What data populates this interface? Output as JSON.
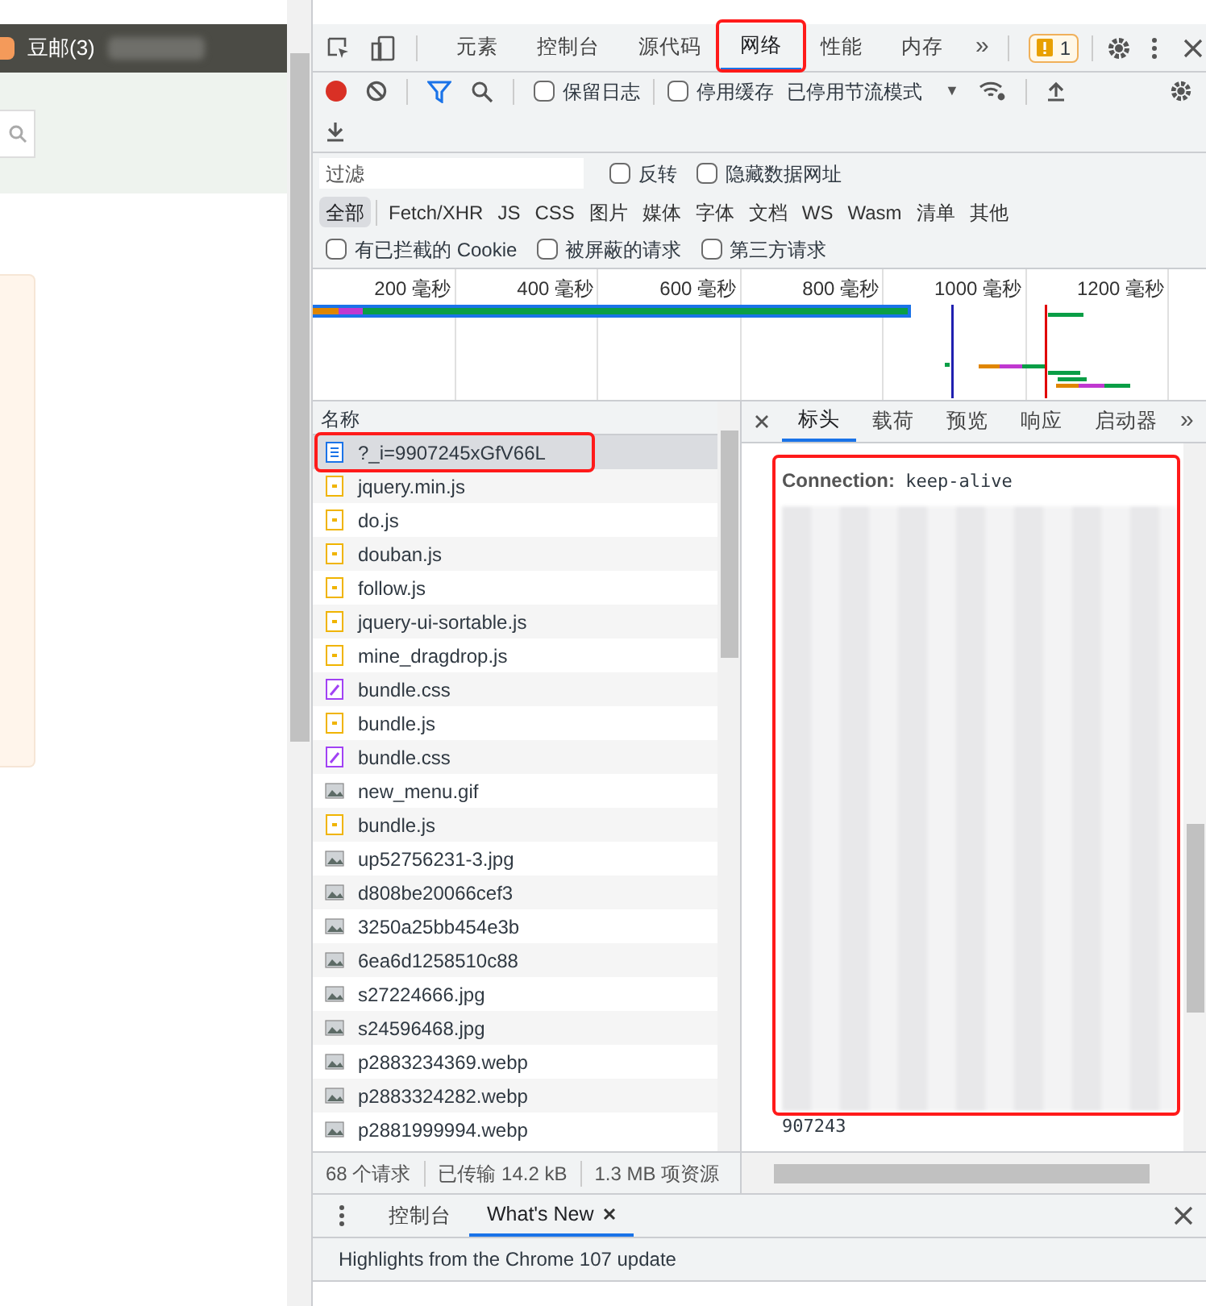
{
  "page": {
    "mail_link": "豆邮(3)"
  },
  "devtools": {
    "tabs": [
      {
        "label": "元素",
        "selected": false,
        "annotated": false
      },
      {
        "label": "控制台",
        "selected": false,
        "annotated": false
      },
      {
        "label": "源代码",
        "selected": false,
        "annotated": false
      },
      {
        "label": "网络",
        "selected": true,
        "annotated": true
      },
      {
        "label": "性能",
        "selected": false,
        "annotated": false
      },
      {
        "label": "内存",
        "selected": false,
        "annotated": false
      }
    ],
    "more_tabs": "»",
    "issues_count": "1",
    "toolbar": {
      "recording": true,
      "preserve_log": {
        "label": "保留日志",
        "checked": false
      },
      "disable_cache": {
        "label": "停用缓存",
        "checked": false
      },
      "throttling": "已停用节流模式",
      "throttling_caret": "▼"
    },
    "filter": {
      "placeholder": "过滤",
      "options": [
        {
          "label": "反转",
          "checked": false
        },
        {
          "label": "隐藏数据网址",
          "checked": false
        }
      ]
    },
    "types": [
      {
        "label": "全部",
        "selected": true
      },
      {
        "label": "Fetch/XHR",
        "selected": false
      },
      {
        "label": "JS",
        "selected": false
      },
      {
        "label": "CSS",
        "selected": false
      },
      {
        "label": "图片",
        "selected": false
      },
      {
        "label": "媒体",
        "selected": false
      },
      {
        "label": "字体",
        "selected": false
      },
      {
        "label": "文档",
        "selected": false
      },
      {
        "label": "WS",
        "selected": false
      },
      {
        "label": "Wasm",
        "selected": false
      },
      {
        "label": "清单",
        "selected": false
      },
      {
        "label": "其他",
        "selected": false
      }
    ],
    "extra_filters": [
      {
        "label": "有已拦截的 Cookie",
        "checked": false
      },
      {
        "label": "被屏蔽的请求",
        "checked": false
      },
      {
        "label": "第三方请求",
        "checked": false
      }
    ],
    "overview_ticks": [
      "200 毫秒",
      "400 毫秒",
      "600 毫秒",
      "800 毫秒",
      "1000 毫秒",
      "1200 毫秒"
    ],
    "requests": {
      "column": "名称",
      "rows": [
        {
          "name": "?_i=9907245xGfV66L",
          "kind": "document",
          "selected": true,
          "annotated": true
        },
        {
          "name": "jquery.min.js",
          "kind": "script",
          "selected": false,
          "annotated": false
        },
        {
          "name": "do.js",
          "kind": "script",
          "selected": false,
          "annotated": false
        },
        {
          "name": "douban.js",
          "kind": "script",
          "selected": false,
          "annotated": false
        },
        {
          "name": "follow.js",
          "kind": "script",
          "selected": false,
          "annotated": false
        },
        {
          "name": "jquery-ui-sortable.js",
          "kind": "script",
          "selected": false,
          "annotated": false
        },
        {
          "name": "mine_dragdrop.js",
          "kind": "script",
          "selected": false,
          "annotated": false
        },
        {
          "name": "bundle.css",
          "kind": "stylesheet",
          "selected": false,
          "annotated": false
        },
        {
          "name": "bundle.js",
          "kind": "script",
          "selected": false,
          "annotated": false
        },
        {
          "name": "bundle.css",
          "kind": "stylesheet",
          "selected": false,
          "annotated": false
        },
        {
          "name": "new_menu.gif",
          "kind": "image",
          "selected": false,
          "annotated": false
        },
        {
          "name": "bundle.js",
          "kind": "script",
          "selected": false,
          "annotated": false
        },
        {
          "name": "up52756231-3.jpg",
          "kind": "image",
          "selected": false,
          "annotated": false
        },
        {
          "name": "d808be20066cef3",
          "kind": "image",
          "selected": false,
          "annotated": false
        },
        {
          "name": "3250a25bb454e3b",
          "kind": "image",
          "selected": false,
          "annotated": false
        },
        {
          "name": "6ea6d1258510c88",
          "kind": "image",
          "selected": false,
          "annotated": false
        },
        {
          "name": "s27224666.jpg",
          "kind": "image",
          "selected": false,
          "annotated": false
        },
        {
          "name": "s24596468.jpg",
          "kind": "image",
          "selected": false,
          "annotated": false
        },
        {
          "name": "p2883234369.webp",
          "kind": "image",
          "selected": false,
          "annotated": false
        },
        {
          "name": "p2883324282.webp",
          "kind": "image",
          "selected": false,
          "annotated": false
        },
        {
          "name": "p2881999994.webp",
          "kind": "image",
          "selected": false,
          "annotated": false
        }
      ]
    },
    "detail_tabs": [
      {
        "label": "标头",
        "selected": true
      },
      {
        "label": "载荷",
        "selected": false
      },
      {
        "label": "预览",
        "selected": false
      },
      {
        "label": "响应",
        "selected": false
      },
      {
        "label": "启动器",
        "selected": false
      }
    ],
    "detail_more": "»",
    "headers_panel": {
      "annotated": true,
      "lines": [
        {
          "name": "Connection:",
          "value": "keep-alive"
        }
      ],
      "tail": "907243"
    },
    "status": [
      "68 个请求",
      "已传输 14.2 kB",
      "1.3 MB 项资源"
    ],
    "drawer": {
      "tabs": [
        {
          "label": "控制台",
          "selected": false,
          "closable": false
        },
        {
          "label": "What's New",
          "selected": true,
          "closable": true
        }
      ],
      "headline": "Highlights from the Chrome 107 update"
    }
  }
}
